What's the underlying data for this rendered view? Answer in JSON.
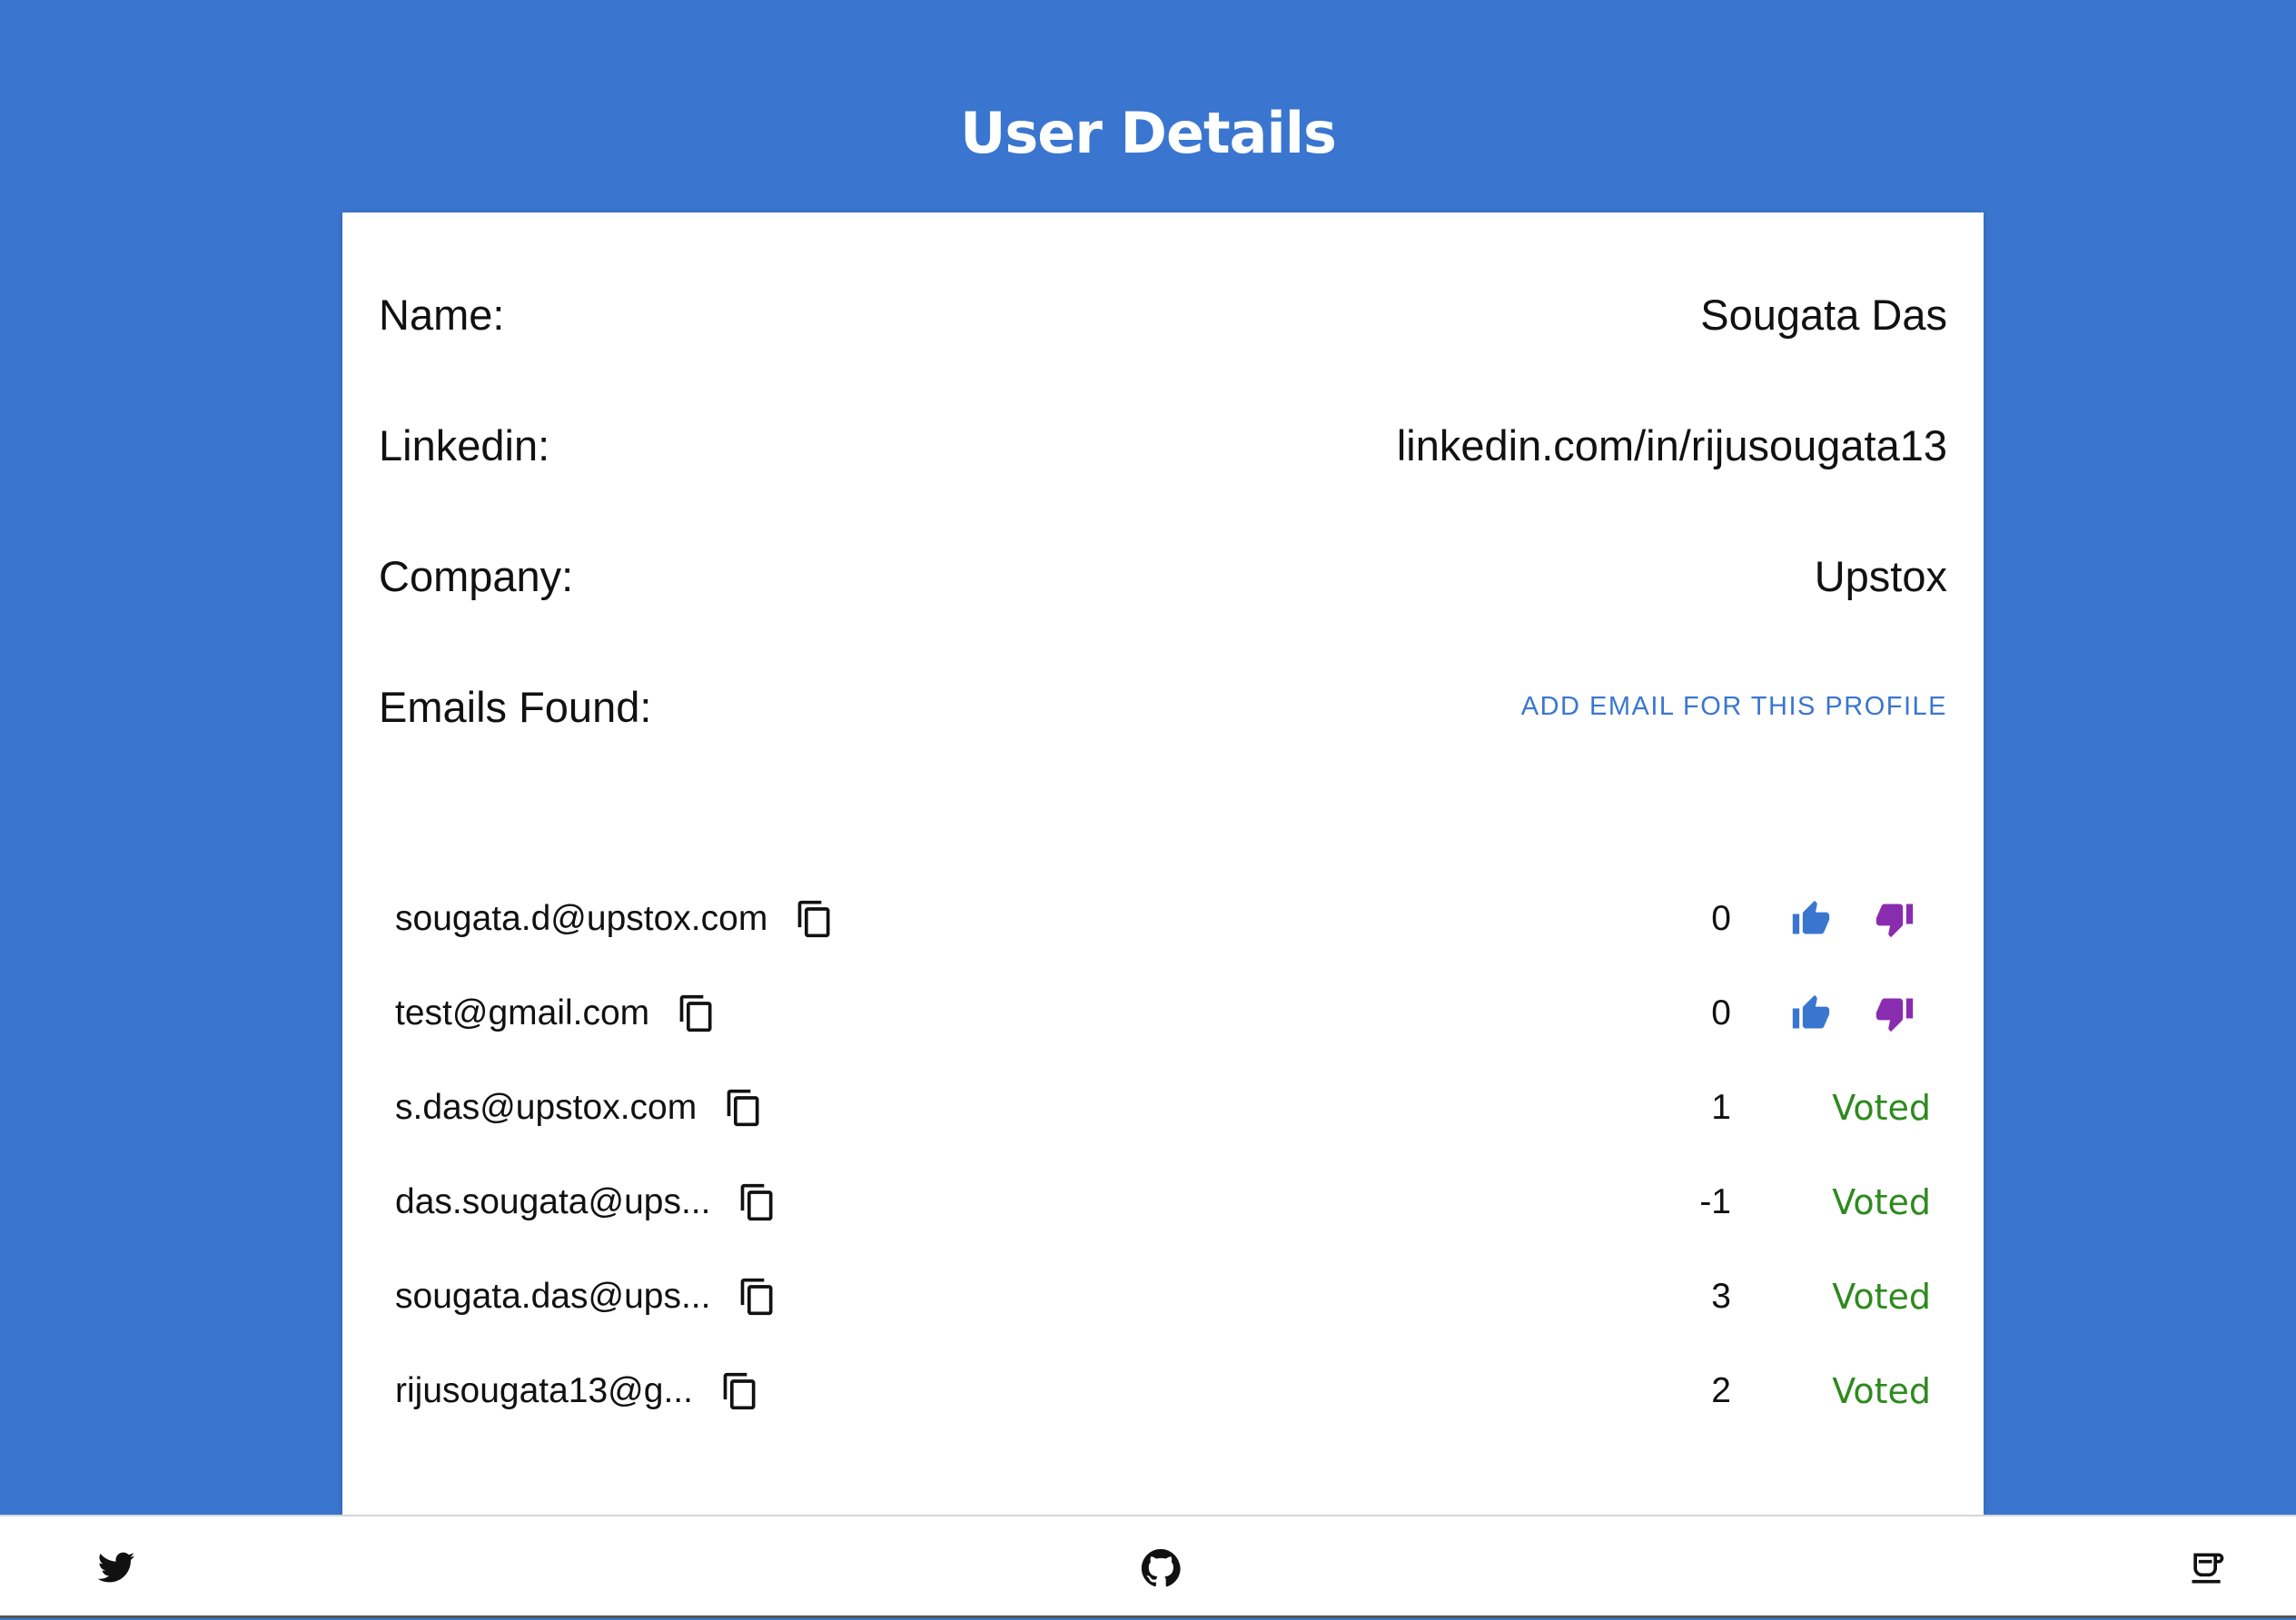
{
  "header": {
    "title": "User Details"
  },
  "profile": {
    "name_label": "Name:",
    "name_value": "Sougata Das",
    "linkedin_label": "Linkedin:",
    "linkedin_value": "linkedin.com/in/rijusougata13",
    "company_label": "Company:",
    "company_value": "Upstox",
    "emails_label": "Emails Found:",
    "add_email_label": "ADD EMAIL FOR THIS PROFILE"
  },
  "emails": [
    {
      "address": "sougata.d@upstox.com",
      "score": "0",
      "status": ""
    },
    {
      "address": "test@gmail.com",
      "score": "0",
      "status": ""
    },
    {
      "address": "s.das@upstox.com",
      "score": "1",
      "status": "Voted"
    },
    {
      "address": "das.sougata@ups...",
      "score": "-1",
      "status": "Voted"
    },
    {
      "address": "sougata.das@ups...",
      "score": "3",
      "status": "Voted"
    },
    {
      "address": "rijusougata13@g...",
      "score": "2",
      "status": "Voted"
    }
  ],
  "colors": {
    "background": "#3a76cf",
    "accent_blue": "#3a76cf",
    "thumb_down_purple": "#8a2cb0",
    "voted_green": "#2e8a1e"
  },
  "icons": {
    "copy": "copy-icon",
    "upvote": "thumb-up-icon",
    "downvote": "thumb-down-icon",
    "footer_left": "twitter-icon",
    "footer_center": "github-icon",
    "footer_right": "coffee-icon"
  }
}
